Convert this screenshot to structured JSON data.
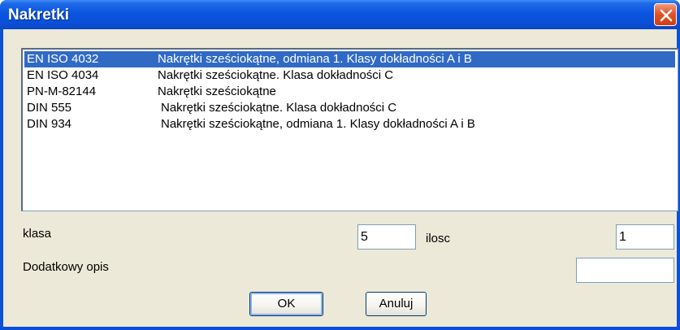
{
  "window": {
    "title": "Nakretki"
  },
  "list": {
    "selected_index": 0,
    "items": [
      {
        "code": "EN ISO 4032",
        "desc": "Nakrętki sześciokątne, odmiana 1. Klasy dokładności A i B"
      },
      {
        "code": "EN ISO 4034",
        "desc": "Nakrętki sześciokątne. Klasa dokładności C"
      },
      {
        "code": "PN-M-82144",
        "desc": "Nakrętki sześciokątne"
      },
      {
        "code": "DIN 555",
        "desc": "Nakrętki sześciokątne. Klasa dokładności C"
      },
      {
        "code": "DIN 934",
        "desc": "Nakrętki sześciokątne, odmiana 1. Klasy dokładności A i B"
      }
    ]
  },
  "form": {
    "klasa_label": "klasa",
    "klasa_value": "5",
    "ilosc_label": "ilosc",
    "ilosc_value": "1",
    "opis_label": "Dodatkowy opis",
    "opis_value": ""
  },
  "buttons": {
    "ok": "OK",
    "cancel": "Anuluj"
  },
  "colors": {
    "titlebar": "#0a55df",
    "selection": "#316ac5",
    "client": "#ece9d8",
    "close": "#e2552b"
  }
}
